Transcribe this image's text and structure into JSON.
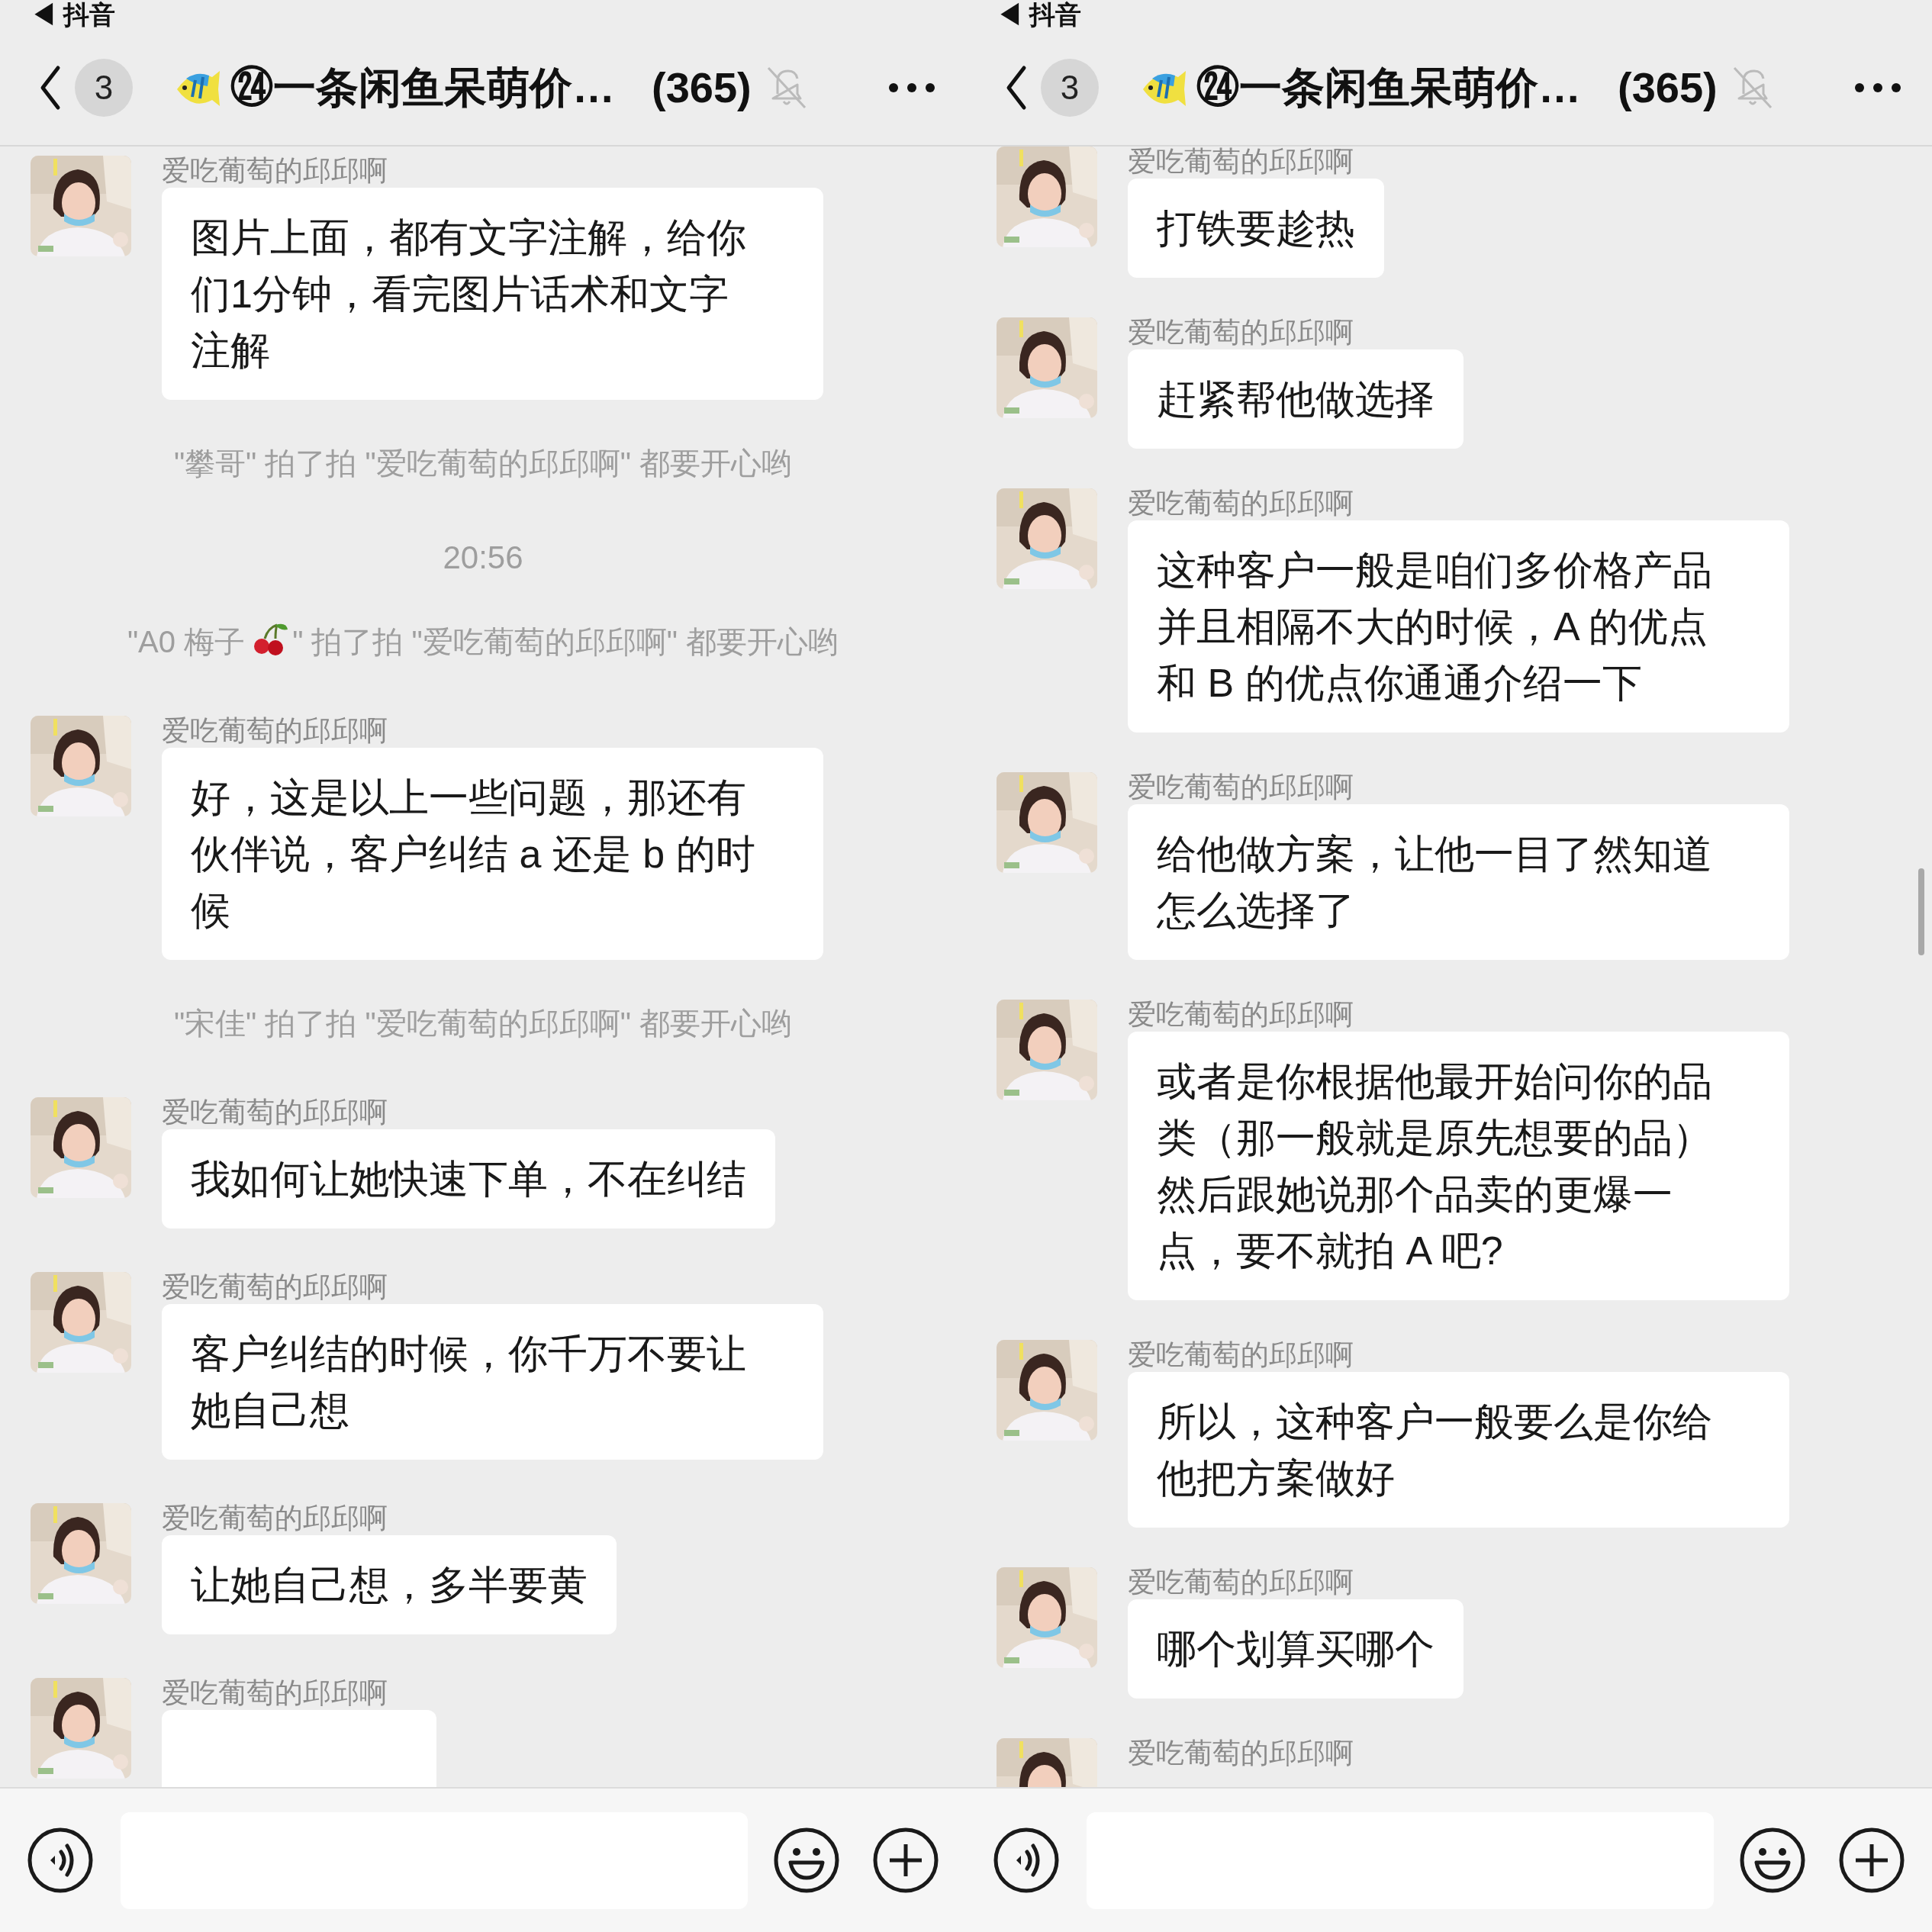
{
  "panes": [
    {
      "status_bar": {
        "back_label": "◀ 抖音"
      },
      "nav": {
        "back_badge": "3",
        "title": "㉔一条闲鱼呆萌价…",
        "member_count": "(365)",
        "muted": true
      },
      "items": [
        {
          "kind": "message",
          "sender": "爱吃葡萄的邱邱啊",
          "lines": [
            "图片上面，都有文字注解，给你",
            "们1分钟，看完图片话术和文字",
            "注解"
          ]
        },
        {
          "kind": "system",
          "segments": [
            "\"攀哥\" 拍了拍 \"爱吃葡萄的邱邱啊\" 都要开心哟"
          ]
        },
        {
          "kind": "time",
          "text": "20:56"
        },
        {
          "kind": "system",
          "segments": [
            "\"A0 梅子",
            "\" 拍了拍 \"爱吃葡萄的邱邱啊\" 都要开心哟"
          ]
        },
        {
          "kind": "message",
          "sender": "爱吃葡萄的邱邱啊",
          "lines": [
            "好，这是以上一些问题，那还有",
            "伙伴说，客户纠结 a 还是 b 的时",
            "候"
          ]
        },
        {
          "kind": "system",
          "segments": [
            "\"宋佳\" 拍了拍 \"爱吃葡萄的邱邱啊\" 都要开心哟"
          ]
        },
        {
          "kind": "message",
          "sender": "爱吃葡萄的邱邱啊",
          "lines": [
            "我如何让她快速下单，不在纠结"
          ]
        },
        {
          "kind": "message",
          "sender": "爱吃葡萄的邱邱啊",
          "lines": [
            "客户纠结的时候，你千万不要让",
            "她自己想"
          ]
        },
        {
          "kind": "message",
          "sender": "爱吃葡萄的邱邱啊",
          "lines": [
            "让她自己想，多半要黄"
          ]
        },
        {
          "kind": "message",
          "sender": "爱吃葡萄的邱邱啊",
          "bubble_cut": true
        }
      ]
    },
    {
      "status_bar": {
        "back_label": "◀ 抖音"
      },
      "nav": {
        "back_badge": "3",
        "title": "㉔一条闲鱼呆萌价…",
        "member_count": "(365)",
        "muted": true
      },
      "items": [
        {
          "kind": "message",
          "sender": "爱吃葡萄的邱邱啊",
          "lines": [
            "打铁要趁热"
          ]
        },
        {
          "kind": "message",
          "sender": "爱吃葡萄的邱邱啊",
          "lines": [
            "赶紧帮他做选择"
          ]
        },
        {
          "kind": "message",
          "sender": "爱吃葡萄的邱邱啊",
          "lines": [
            "这种客户一般是咱们多价格产品",
            "并且相隔不大的时候，A 的优点",
            "和 B 的优点你通通介绍一下"
          ]
        },
        {
          "kind": "message",
          "sender": "爱吃葡萄的邱邱啊",
          "lines": [
            "给他做方案，让他一目了然知道",
            "怎么选择了"
          ]
        },
        {
          "kind": "message",
          "sender": "爱吃葡萄的邱邱啊",
          "lines": [
            "或者是你根据他最开始问你的品",
            "类（那一般就是原先想要的品）",
            "然后跟她说那个品卖的更爆一",
            "点，要不就拍 A 吧?"
          ]
        },
        {
          "kind": "message",
          "sender": "爱吃葡萄的邱邱啊",
          "lines": [
            "所以，这种客户一般要么是你给",
            "他把方案做好"
          ]
        },
        {
          "kind": "message",
          "sender": "爱吃葡萄的邱邱啊",
          "lines": [
            "哪个划算买哪个"
          ]
        },
        {
          "kind": "message",
          "sender": "爱吃葡萄的邱邱啊"
        }
      ],
      "scrollbar_visible": true
    }
  ]
}
